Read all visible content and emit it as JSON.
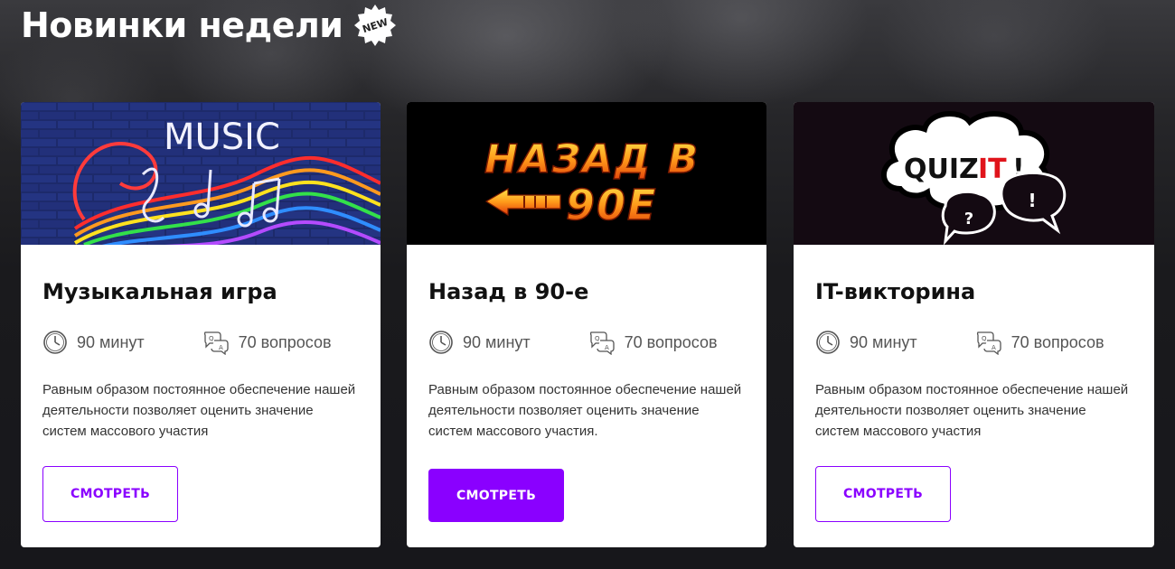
{
  "page": {
    "title": "Новинки недели",
    "badge": "NEW",
    "accent_color": "#8a00ff"
  },
  "cards": [
    {
      "title": "Музыкальная игра",
      "image_text": "MUSIC",
      "duration": "90 минут",
      "questions": "70 вопросов",
      "description": "Равным образом постоянное обеспечение нашей деятельности позволяет оценить значение систем массового участия",
      "button_label": "СМОТРЕТЬ",
      "button_style": "outline"
    },
    {
      "title": "Назад в 90-е",
      "image_text_line1": "НАЗАД В",
      "image_text_line2": "90Е",
      "duration": "90 минут",
      "questions": "70 вопросов",
      "description": "Равным образом постоянное обеспечение нашей деятельности позволяет оценить значение систем массового участия.",
      "button_label": "СМОТРЕТЬ",
      "button_style": "filled"
    },
    {
      "title": "IT-викторина",
      "image_text_a": "QUIZ",
      "image_text_b": "IT",
      "image_text_c": "!",
      "duration": "90 минут",
      "questions": "70 вопросов",
      "description": "Равным образом постоянное обеспечение нашей деятельности позволяет оценить значение систем массового участия",
      "button_label": "СМОТРЕТЬ",
      "button_style": "outline"
    }
  ],
  "icons": {
    "duration": "clock-icon",
    "questions": "qa-icon",
    "badge": "new-badge-icon"
  }
}
